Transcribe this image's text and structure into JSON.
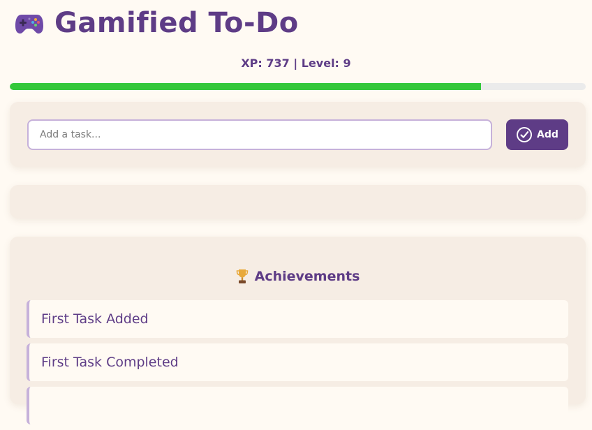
{
  "header": {
    "icon": "gamepad-icon",
    "title": "Gamified To-Do"
  },
  "stats": {
    "text": "XP: 737 | Level: 9",
    "xp": 737,
    "level": 9,
    "progress_fraction": 0.818
  },
  "input": {
    "placeholder": "Add a task...",
    "value": ""
  },
  "add_button": {
    "label": "Add",
    "icon": "check-circle-icon"
  },
  "achievements": {
    "icon": "trophy-icon",
    "title": "Achievements",
    "items": [
      {
        "label": "First Task Added"
      },
      {
        "label": "First Task Completed"
      },
      {
        "label": ""
      }
    ]
  },
  "colors": {
    "accent": "#5e3c86",
    "progress": "#34c83b",
    "card": "#f6ede4",
    "background": "#fffaf3",
    "border": "#c6b1da"
  }
}
